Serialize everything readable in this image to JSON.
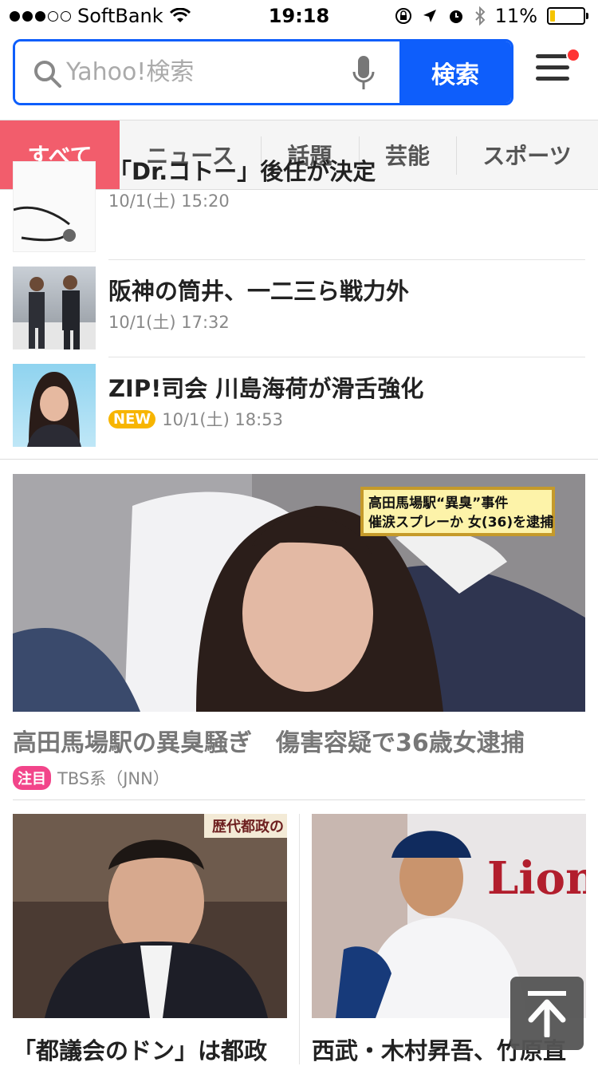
{
  "status": {
    "carrier": "SoftBank",
    "time": "19:18",
    "battery": "11%"
  },
  "search": {
    "placeholder": "Yahoo!検索",
    "button_label": "検索"
  },
  "tabs": [
    {
      "label": "すべて"
    },
    {
      "label": "ニュース"
    },
    {
      "label": "話題"
    },
    {
      "label": "芸能"
    },
    {
      "label": "スポーツ"
    }
  ],
  "list": [
    {
      "title": "「Dr.コトー」後任が決定",
      "date": "10/1(土) 15:20"
    },
    {
      "title": "阪神の筒井、一二三ら戦力外",
      "date": "10/1(土) 17:32"
    },
    {
      "title": "ZIP!司会 川島海荷が滑舌強化",
      "badge": "NEW",
      "date": "10/1(土) 18:53"
    }
  ],
  "feature": {
    "caption_line1": "高田馬場駅“異臭”事件",
    "caption_line2": "催涙スプレーか 女(36)を逮捕",
    "title": "高田馬場駅の異臭騒ぎ　傷害容疑で36歳女逮捕",
    "badge": "注目",
    "source": "TBS系（JNN）"
  },
  "cards": [
    {
      "title": "「都議会のドン」は都政",
      "image_text": "歴代都政の"
    },
    {
      "title": "西武・木村昇吾、竹原直",
      "image_text": "Lions"
    }
  ],
  "colors": {
    "accent": "#0e5efb",
    "tab_active": "#f25d6c",
    "new_badge": "#f7b500",
    "hot_badge": "#f2458a"
  }
}
